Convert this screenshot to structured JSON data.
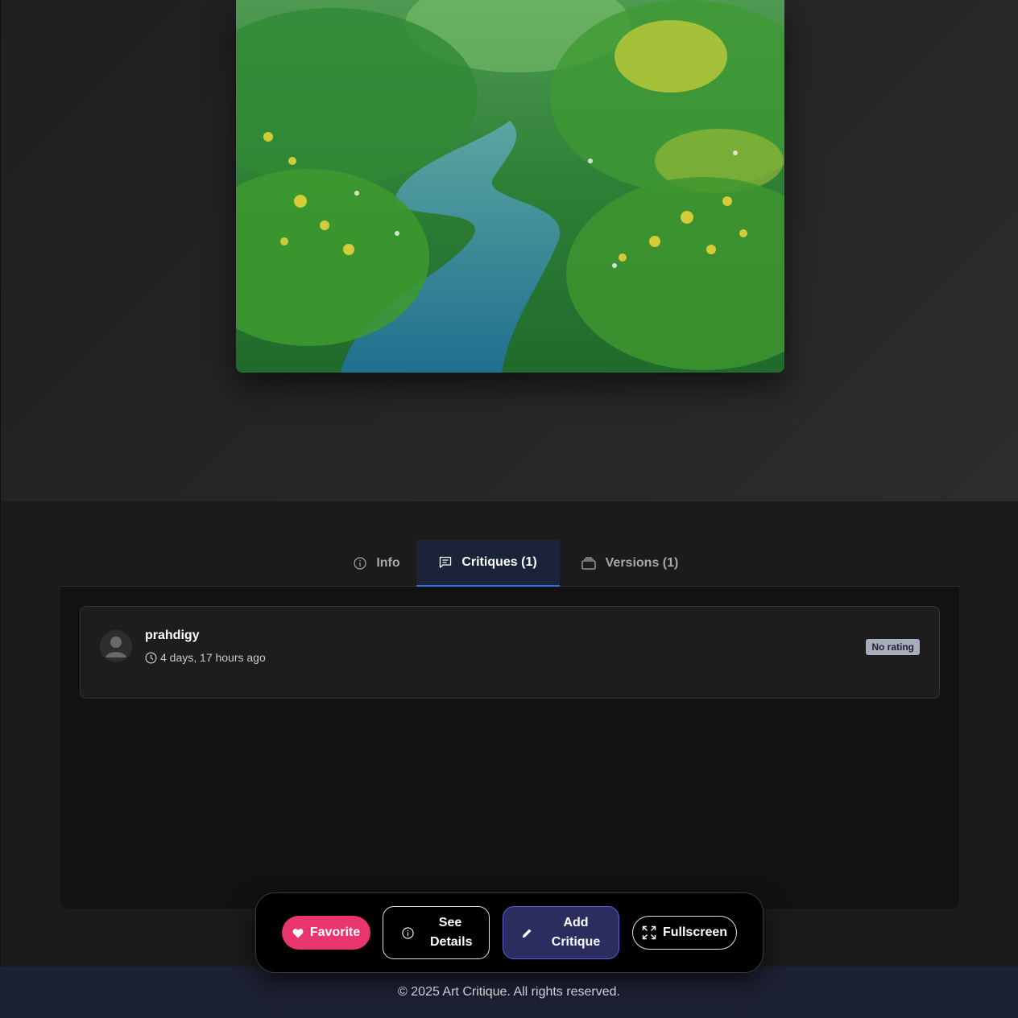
{
  "tabs": [
    {
      "label": "Info",
      "icon": "info-icon"
    },
    {
      "label": "Critiques (1)",
      "icon": "chat-icon",
      "active": true
    },
    {
      "label": "Versions (1)",
      "icon": "layers-icon"
    }
  ],
  "critique": {
    "author": "prahdigy",
    "time": "4 days, 17 hours ago",
    "rating": "No rating"
  },
  "actions": {
    "favorite": "Favorite",
    "see_details": "See Details",
    "add_critique": "Add Critique",
    "fullscreen": "Fullscreen"
  },
  "footer": {
    "text": "© 2025 Art Critique. All rights reserved."
  },
  "colors": {
    "favorite": "#e8356e",
    "active_tab_underline": "#2f6fe0",
    "add_critique": "#2b2d5e"
  }
}
